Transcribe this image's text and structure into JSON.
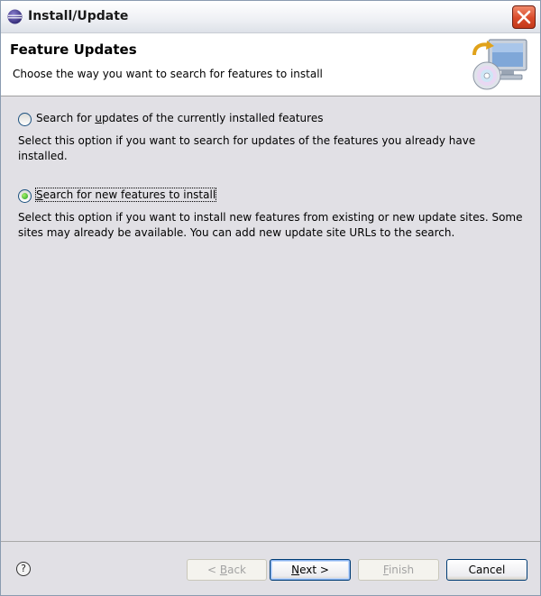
{
  "window": {
    "title": "Install/Update"
  },
  "header": {
    "title": "Feature Updates",
    "description": "Choose the way you want to search for features to install"
  },
  "options": [
    {
      "label_pre": "Search for ",
      "label_mnemonic": "u",
      "label_post": "pdates of the currently installed features",
      "description": "Select this option if you want to search for updates of the features you already have installed.",
      "selected": false
    },
    {
      "label_pre": "",
      "label_mnemonic": "S",
      "label_post": "earch for new features to install",
      "description": "Select this option if you want to install new features from existing or new update sites. Some sites may already be available. You can add new update site URLs to the search.",
      "selected": true
    }
  ],
  "footer": {
    "help_glyph": "?",
    "back": {
      "pre": "< ",
      "mnemonic": "B",
      "post": "ack",
      "enabled": false
    },
    "next": {
      "pre": "",
      "mnemonic": "N",
      "post": "ext >",
      "enabled": true
    },
    "finish": {
      "pre": "",
      "mnemonic": "F",
      "post": "inish",
      "enabled": false
    },
    "cancel": {
      "label": "Cancel",
      "enabled": true
    }
  },
  "colors": {
    "accent": "#003c74",
    "selected_radio": "#21a121",
    "close_button": "#d94a2a"
  }
}
